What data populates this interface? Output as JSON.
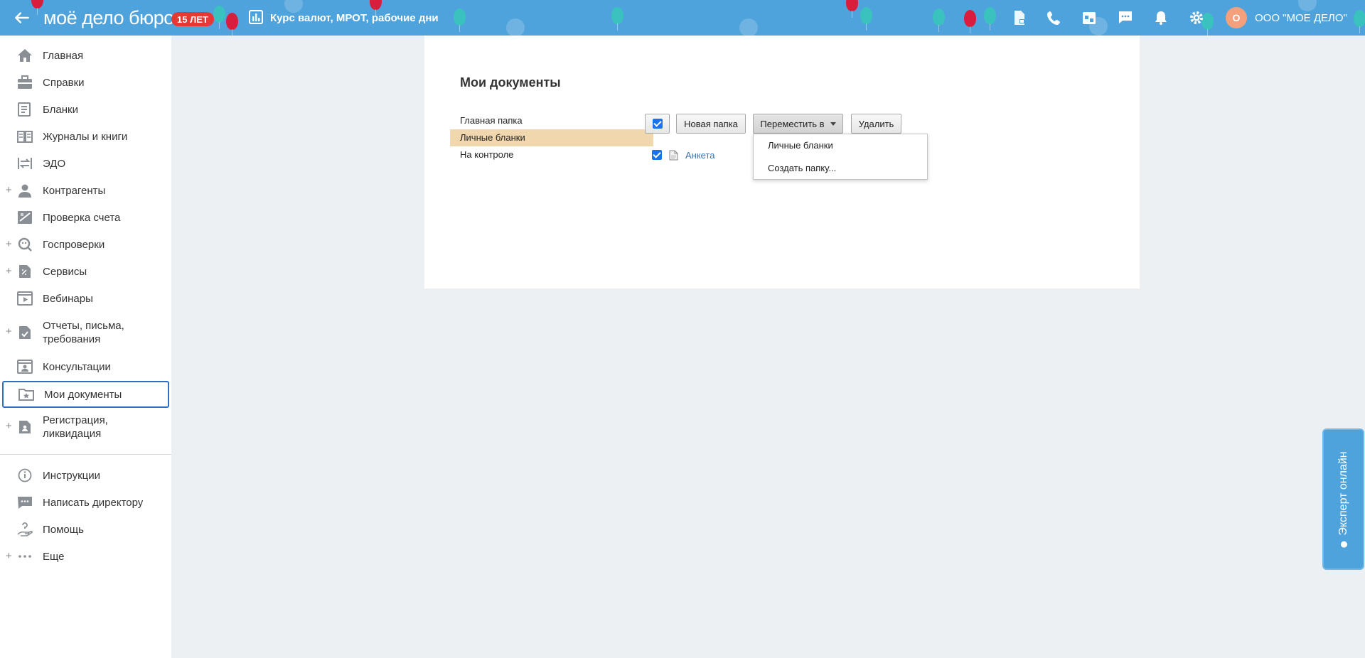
{
  "topbar": {
    "logo": "моё дело бюро",
    "badge": "15 ЛЕТ",
    "rates_link": "Курс валют, МРОТ, рабочие дни",
    "avatar_letter": "О",
    "company": "ООО \"МОЕ ДЕЛО\""
  },
  "sidebar": {
    "items": [
      {
        "label": "Главная"
      },
      {
        "label": "Справки"
      },
      {
        "label": "Бланки"
      },
      {
        "label": "Журналы и книги"
      },
      {
        "label": "ЭДО"
      },
      {
        "label": "Контрагенты"
      },
      {
        "label": "Проверка счета"
      },
      {
        "label": "Госпроверки"
      },
      {
        "label": "Сервисы"
      },
      {
        "label": "Вебинары"
      },
      {
        "label": "Отчеты, письма, требования"
      },
      {
        "label": "Консультации"
      },
      {
        "label": "Мои документы"
      },
      {
        "label": "Регистрация, ликвидация"
      }
    ],
    "bottom_items": [
      {
        "label": "Инструкции"
      },
      {
        "label": "Написать директору"
      },
      {
        "label": "Помощь"
      },
      {
        "label": "Еще"
      }
    ]
  },
  "documents": {
    "title": "Мои документы",
    "folders": [
      {
        "label": "Главная папка"
      },
      {
        "label": "Личные бланки"
      },
      {
        "label": "На контроле"
      }
    ],
    "toolbar": {
      "new_folder": "Новая папка",
      "move_to": "Переместить в",
      "delete": "Удалить"
    },
    "files": [
      {
        "name": "Анкета"
      }
    ],
    "move_menu": [
      {
        "label": "Личные бланки"
      },
      {
        "label": "Создать папку..."
      }
    ]
  },
  "expert_tab": {
    "label": "Эксперт онлайн"
  }
}
